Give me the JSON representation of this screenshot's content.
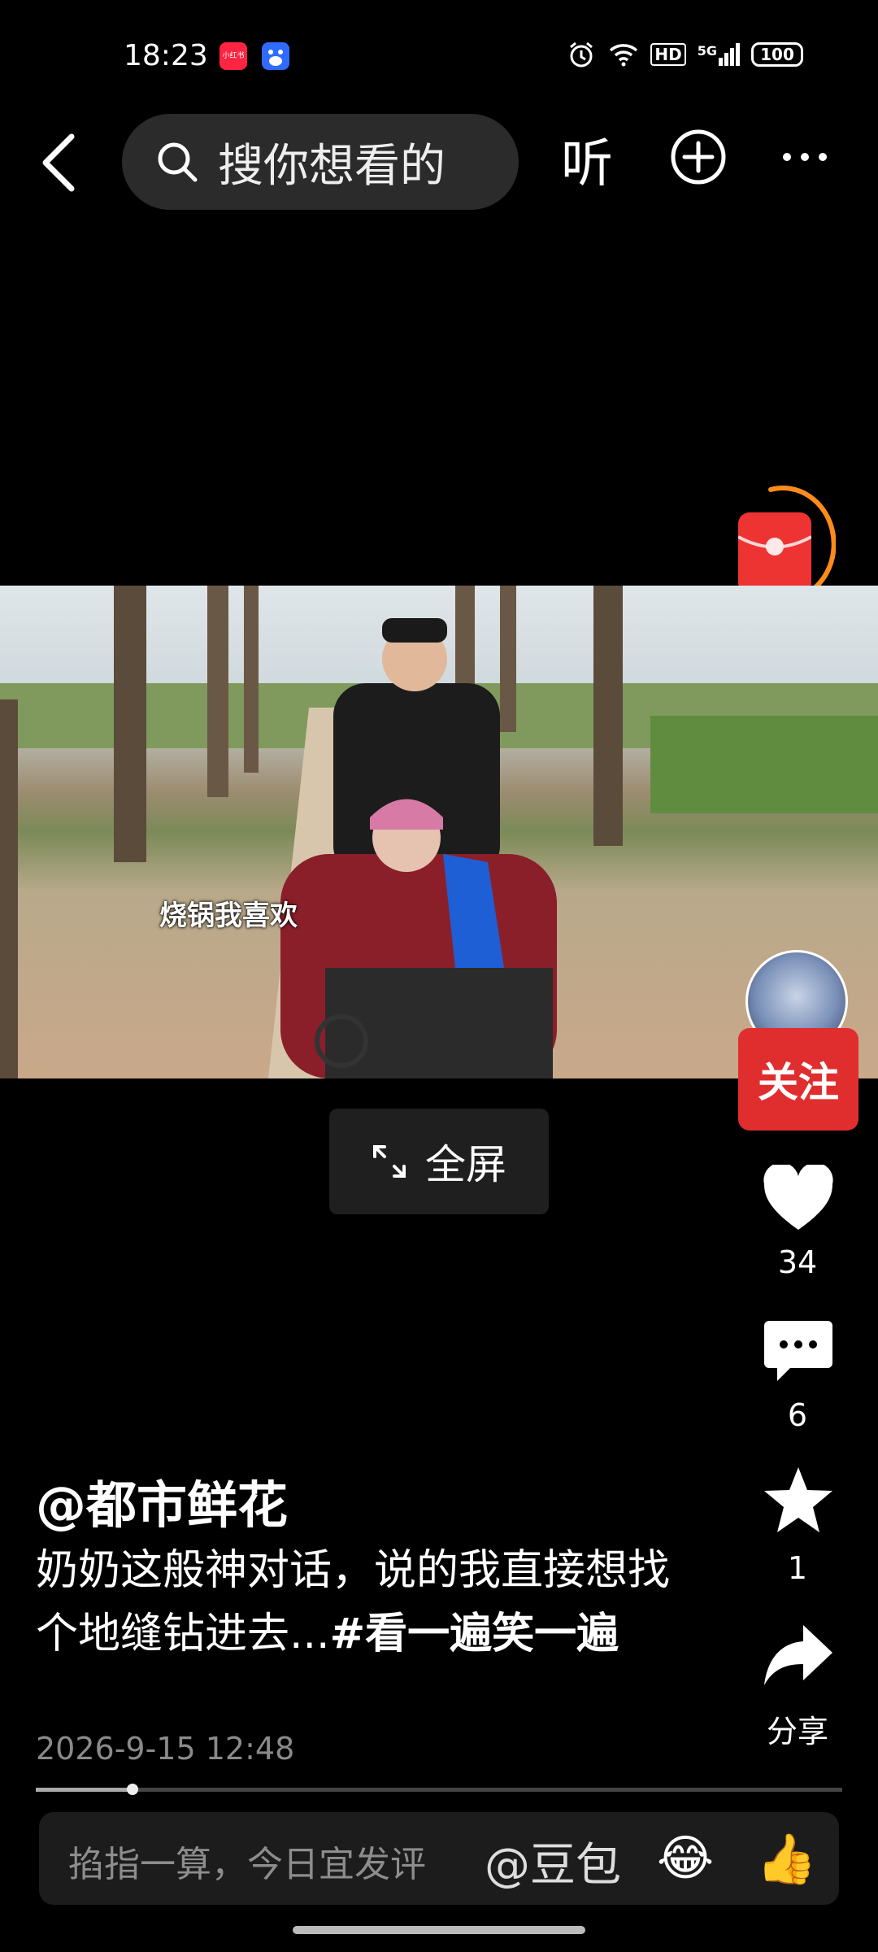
{
  "status_bar": {
    "time": "18:23",
    "app_badge": "小红书",
    "network": "5G",
    "hd": "HD",
    "battery": "100"
  },
  "nav": {
    "search_placeholder": "搜你想看的",
    "listen_label": "听"
  },
  "video": {
    "subtitle": "烧锅我喜欢",
    "fullscreen_label": "全屏"
  },
  "rail": {
    "follow_label": "关注",
    "likes": "34",
    "comments": "6",
    "favorites": "1",
    "share_label": "分享"
  },
  "post": {
    "author": "@都市鲜花",
    "caption_text": "奶奶这般神对话，说的我直接想找个地缝钻进去...",
    "hashtag": "#看一遍笑一遍",
    "date": "2026-9-15 12:48",
    "progress_fraction": 0.12
  },
  "comment_bar": {
    "placeholder": "掐指一算，今日宜发评",
    "mention": "@豆包",
    "emoji_1": "😂",
    "emoji_2": "👍"
  },
  "colors": {
    "follow_red": "#e02e2e",
    "red_packet": "#e33333",
    "ring_orange": "#ff8c1a"
  }
}
